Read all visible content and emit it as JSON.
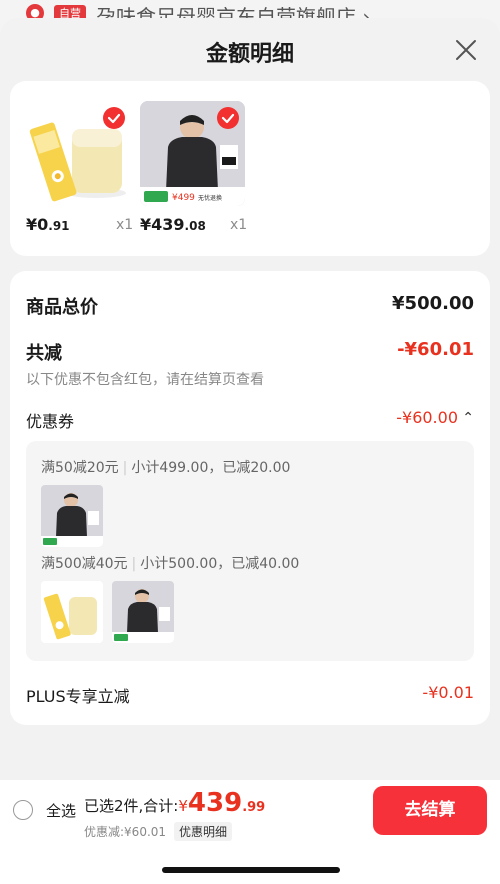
{
  "background_page": {
    "badge": "自营",
    "shop_name": "孕味食足母婴京东自营旗舰店 ›"
  },
  "sheet": {
    "title": "金额明细"
  },
  "products": [
    {
      "price_int": "¥0",
      "price_dec": ".91",
      "qty": "x1",
      "image": "milk-drink-image"
    },
    {
      "price_int": "¥439",
      "price_dec": ".08",
      "qty": "x1",
      "image": "jacket-image"
    }
  ],
  "summary": {
    "total_label": "商品总价",
    "total_value": "¥500.00",
    "reduce_label": "共减",
    "reduce_value": "-¥60.01",
    "reduce_note": "以下优惠不包含红包，请在结算页查看",
    "coupon_label": "优惠券",
    "coupon_value": "-¥60.00",
    "coupon_toggle": "⌃",
    "coupons": [
      {
        "rule": "满50减20元",
        "detail": "小计499.00，已减20.00"
      },
      {
        "rule": "满500减40元",
        "detail": "小计500.00，已减40.00"
      }
    ],
    "plus_label": "PLUS专享立减",
    "plus_value": "-¥0.01"
  },
  "bottom": {
    "select_all": "全选",
    "selected_text": "已选2件,合计:",
    "currency": "¥",
    "total_int": "439",
    "total_dec": ".99",
    "discount_text": "优惠减:¥60.01",
    "detail_link": "优惠明细",
    "checkout_label": "去结算"
  },
  "colors": {
    "accent_red": "#e8321f",
    "button_red": "#f7313a",
    "check_red": "#f23030"
  }
}
